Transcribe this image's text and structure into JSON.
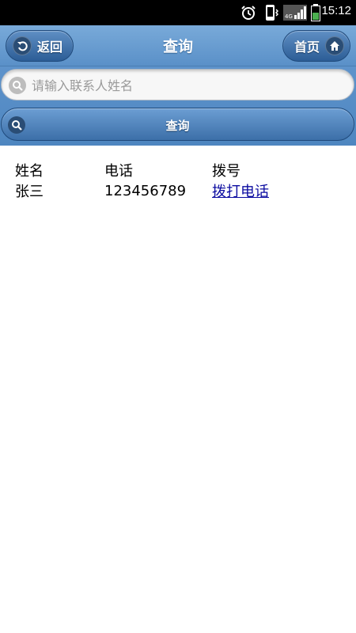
{
  "status_bar": {
    "time": "15:12",
    "network": "4G"
  },
  "header": {
    "title": "查询",
    "back_label": "返回",
    "home_label": "首页"
  },
  "search": {
    "placeholder": "请输入联系人姓名",
    "value": "",
    "button_label": "查询"
  },
  "table": {
    "headers": [
      "姓名",
      "电话",
      "拨号"
    ],
    "rows": [
      {
        "name": "张三",
        "phone": "123456789",
        "dial_label": "拨打电话"
      }
    ]
  },
  "colors": {
    "header_bg": "#6a9ed2",
    "button_bg": "#2c5d96",
    "link": "#0b0ba0"
  }
}
